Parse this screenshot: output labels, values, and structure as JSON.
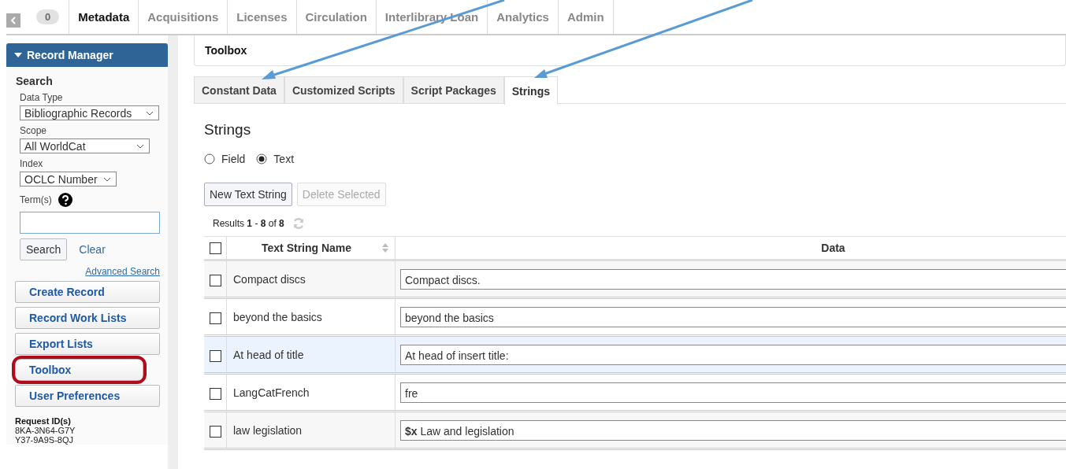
{
  "top_nav": {
    "badge": "0",
    "tabs": [
      {
        "label": "Metadata",
        "selected": true
      },
      {
        "label": "Acquisitions",
        "selected": false
      },
      {
        "label": "Licenses",
        "selected": false
      },
      {
        "label": "Circulation",
        "selected": false
      },
      {
        "label": "Interlibrary Loan",
        "selected": false
      },
      {
        "label": "Analytics",
        "selected": false
      },
      {
        "label": "Admin",
        "selected": false
      }
    ]
  },
  "sidebar": {
    "header": "Record Manager",
    "expanded": true,
    "search_title": "Search",
    "fields": [
      {
        "label": "Data Type",
        "value": "Bibliographic Records"
      },
      {
        "label": "Scope",
        "value": "All WorldCat"
      },
      {
        "label": "Index",
        "value": "OCLC Number"
      }
    ],
    "terms_label": "Term(s)",
    "search_button": "Search",
    "clear_link": "Clear",
    "advanced_link": "Advanced Search",
    "buttons": [
      {
        "label": "Create Record",
        "highlighted": false
      },
      {
        "label": "Record Work Lists",
        "highlighted": false
      },
      {
        "label": "Export Lists",
        "highlighted": false
      },
      {
        "label": "Toolbox",
        "highlighted": true
      },
      {
        "label": "User Preferences",
        "highlighted": false
      }
    ],
    "request_title": "Request ID(s)",
    "request_ids": [
      "8KA-3N64-G7Y",
      "Y37-9A9S-8QJ"
    ]
  },
  "panel_title": "Toolbox",
  "tabs": [
    {
      "label": "Constant Data",
      "selected": false
    },
    {
      "label": "Customized Scripts",
      "selected": false
    },
    {
      "label": "Script Packages",
      "selected": false
    },
    {
      "label": "Strings",
      "selected": true
    }
  ],
  "heading": "Strings",
  "radios": [
    {
      "label": "Field",
      "selected": false
    },
    {
      "label": "Text",
      "selected": true
    }
  ],
  "actions": [
    {
      "label": "New Text String",
      "disabled": false
    },
    {
      "label": "Delete Selected",
      "disabled": true
    }
  ],
  "results": "Results **1** - **8** of **8**",
  "table": {
    "all_checked": false,
    "columns": [
      "Text String Name",
      "Data"
    ],
    "rows": [
      {
        "name": "Compact discs",
        "data": "Compact discs.",
        "checked": false,
        "selected": false
      },
      {
        "name": "beyond the basics",
        "data": "beyond the basics",
        "checked": false,
        "selected": false
      },
      {
        "name": "At head of title",
        "data": "At head of insert title:",
        "checked": false,
        "selected": true
      },
      {
        "name": "LangCatFrench",
        "data": "fre",
        "checked": false,
        "selected": false
      },
      {
        "name": "law legislation",
        "data": "**$x** Law and legislation",
        "checked": false,
        "selected": false
      }
    ]
  }
}
